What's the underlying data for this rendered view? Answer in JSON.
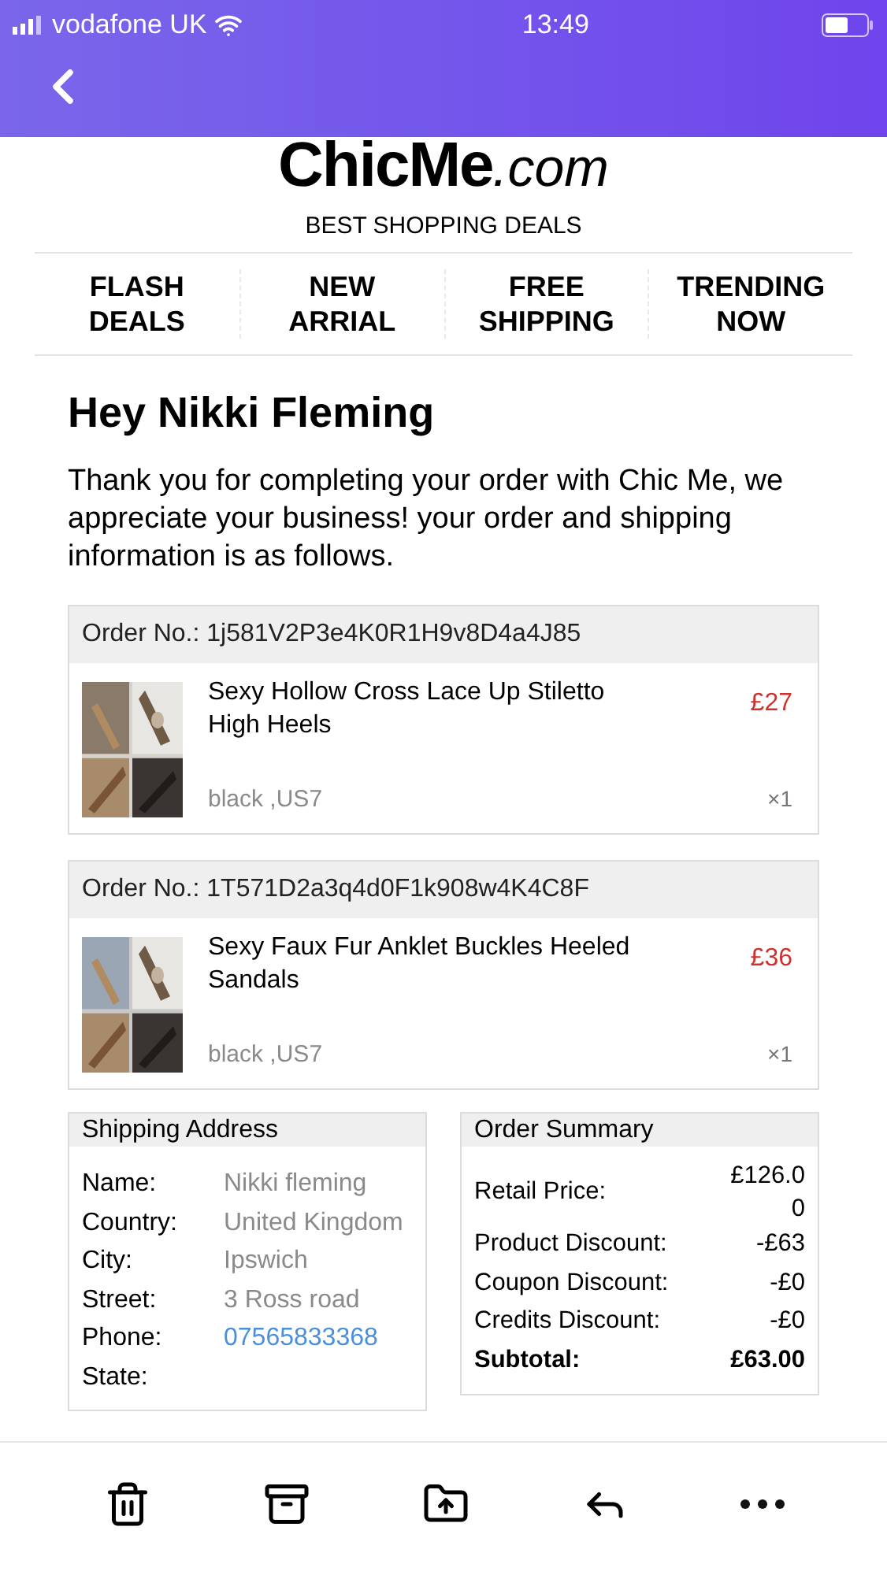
{
  "status_bar": {
    "carrier": "vodafone UK",
    "time": "13:49"
  },
  "logo": {
    "brand": "ChicMe",
    "domain": ".com",
    "tagline": "BEST SHOPPING DEALS"
  },
  "nav": [
    {
      "line1": "FLASH",
      "line2": "DEALS"
    },
    {
      "line1": "NEW",
      "line2": "ARRIAL"
    },
    {
      "line1": "FREE",
      "line2": "SHIPPING"
    },
    {
      "line1": "TRENDING",
      "line2": "NOW"
    }
  ],
  "greeting": "Hey Nikki Fleming",
  "message": "Thank you for completing your order with Chic Me, we appreciate your business! your order and shipping information is as follows.",
  "orders": [
    {
      "label": "Order No.:",
      "number": "1j581V2P3e4K0R1H9v8D4a4J85",
      "product": "Sexy Hollow Cross Lace Up Stiletto High Heels",
      "price": "£27",
      "variant": "black ,US7",
      "quantity": "×1"
    },
    {
      "label": "Order No.:",
      "number": "1T571D2a3q4d0F1k908w4K4C8F",
      "product": "Sexy Faux Fur Anklet Buckles Heeled Sandals",
      "price": "£36",
      "variant": "black ,US7",
      "quantity": "×1"
    }
  ],
  "shipping_address": {
    "title": "Shipping Address",
    "rows": [
      {
        "label": "Name:",
        "value": "Nikki fleming",
        "kind": "text"
      },
      {
        "label": "Country:",
        "value": "United Kingdom",
        "kind": "text"
      },
      {
        "label": "City:",
        "value": "Ipswich",
        "kind": "text"
      },
      {
        "label": "Street:",
        "value": "3 Ross road",
        "kind": "text"
      },
      {
        "label": "Phone:",
        "value": "07565833368",
        "kind": "link"
      },
      {
        "label": "State:",
        "kind": "text"
      }
    ]
  },
  "order_summary": {
    "title": "Order Summary",
    "rows": [
      {
        "label": "Retail Price:",
        "value": "£126.00",
        "kind": "normal"
      },
      {
        "label": "Product Discount:",
        "value": "-£63",
        "kind": "normal"
      },
      {
        "label": "Coupon Discount:",
        "value": "-£0",
        "kind": "normal"
      },
      {
        "label": "Credits Discount:",
        "value": "-£0",
        "kind": "normal"
      },
      {
        "label": "Subtotal:",
        "value": "£63.00",
        "kind": "total"
      }
    ]
  }
}
